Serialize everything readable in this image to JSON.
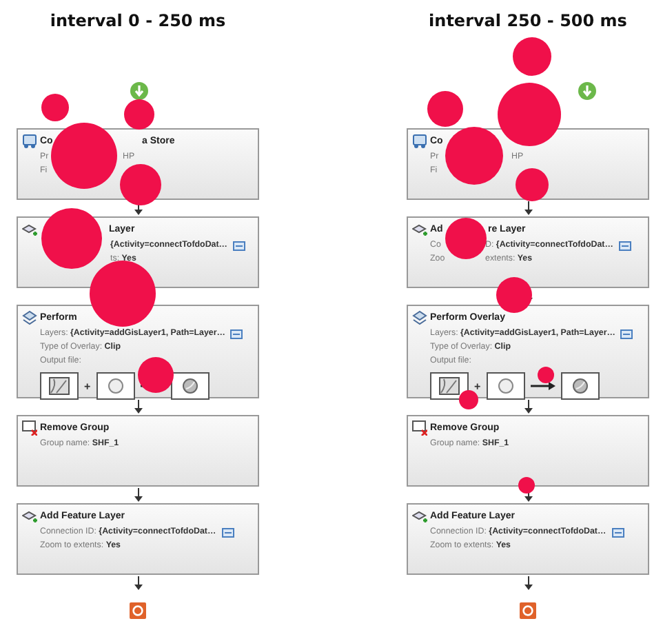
{
  "panels": [
    {
      "title": "interval 0 - 250 ms",
      "steps": [
        {
          "kind": "connect",
          "title": [
            "Co",
            "a Store"
          ],
          "lines": [
            {
              "segments": [
                "Pr",
                "HP"
              ]
            },
            {
              "segments": [
                "Fi"
              ]
            }
          ]
        },
        {
          "kind": "add-layer",
          "title": [
            "Layer"
          ],
          "lines": [
            {
              "segments": [
                "**{Activity=connectTofdoDat…**"
              ],
              "editor": true
            },
            {
              "segments": [
                "ts: **Yes**"
              ]
            }
          ]
        },
        {
          "kind": "overlay",
          "title": [
            "Perform"
          ],
          "lines": [
            {
              "segments": [
                "Layers:  **{Activity=addGisLayer1, Path=Layer…**"
              ],
              "editor": true
            },
            {
              "segments": [
                "Type of Overlay: **Clip**"
              ]
            },
            {
              "segments": [
                "Output file:"
              ]
            }
          ],
          "operator": "+"
        },
        {
          "kind": "remove-group",
          "title": [
            "Remove Group"
          ],
          "lines": [
            {
              "segments": [
                "Group name: **SHF_1**"
              ]
            }
          ]
        },
        {
          "kind": "add-layer",
          "title": [
            "Add Feature Layer"
          ],
          "lines": [
            {
              "segments": [
                "Connection ID:  **{Activity=connectTofdoDat…**"
              ],
              "editor": true
            },
            {
              "segments": [
                "Zoom to extents: **Yes**"
              ]
            }
          ]
        }
      ]
    },
    {
      "title": "interval 250 - 500 ms",
      "steps": [
        {
          "kind": "connect",
          "title": [
            "Co"
          ],
          "lines": [
            {
              "segments": [
                "Pr",
                "HP"
              ]
            },
            {
              "segments": [
                "Fi"
              ]
            }
          ]
        },
        {
          "kind": "add-layer",
          "title": [
            "Ad",
            "re Layer"
          ],
          "lines": [
            {
              "segments": [
                "Co",
                "D:  **{Activity=connectTofdoDat…**"
              ],
              "editor": true
            },
            {
              "segments": [
                "Zoo",
                "extents: **Yes**"
              ]
            }
          ]
        },
        {
          "kind": "overlay",
          "title": [
            "Perform Overlay"
          ],
          "lines": [
            {
              "segments": [
                "Layers:  **{Activity=addGisLayer1, Path=Layer…**"
              ],
              "editor": true
            },
            {
              "segments": [
                "Type of Overlay: **Clip**"
              ]
            },
            {
              "segments": [
                "Output file:"
              ]
            }
          ],
          "operator": "+"
        },
        {
          "kind": "remove-group",
          "title": [
            "Remove Group"
          ],
          "lines": [
            {
              "segments": [
                "Group name: **SHF_1**"
              ]
            }
          ]
        },
        {
          "kind": "add-layer",
          "title": [
            "Add Feature Layer"
          ],
          "lines": [
            {
              "segments": [
                "Connection ID:  **{Activity=connectTofdoDat…**"
              ],
              "editor": true
            },
            {
              "segments": [
                "Zoom to extents: **Yes**"
              ]
            }
          ]
        }
      ]
    }
  ]
}
